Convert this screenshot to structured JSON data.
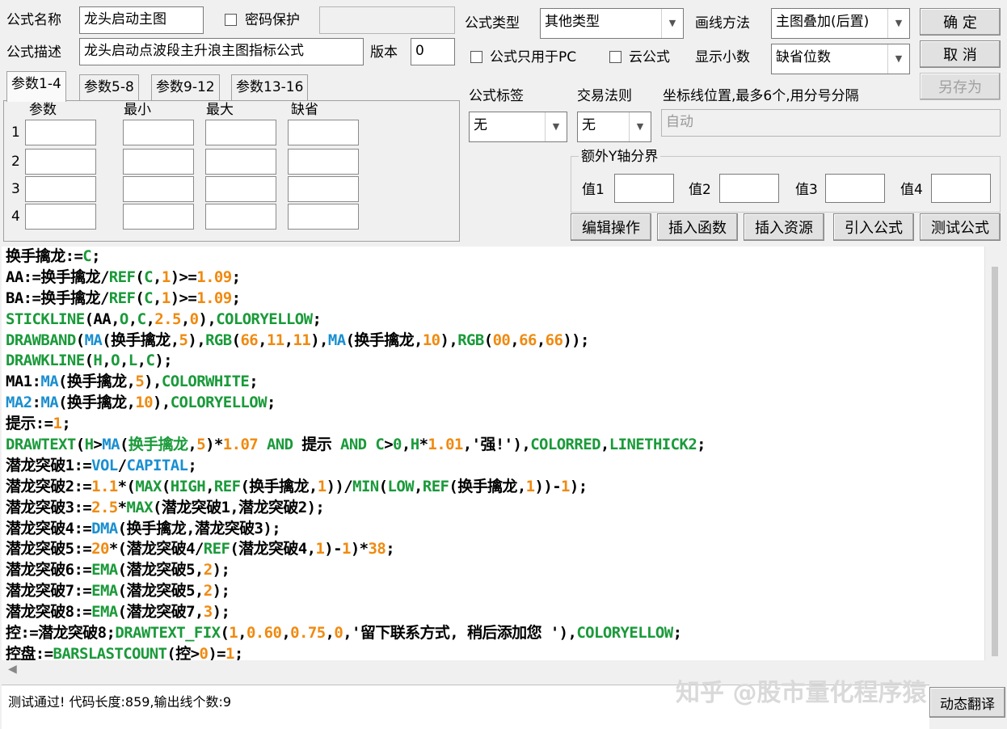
{
  "form": {
    "name_label": "公式名称",
    "name_value": "龙头启动主图",
    "password_label": "密码保护",
    "desc_label": "公式描述",
    "desc_value": "龙头启动点波段主升浪主图指标公式",
    "version_label": "版本",
    "version_value": "0",
    "type_label": "公式类型",
    "type_value": "其他类型",
    "draw_label": "画线方法",
    "draw_value": "主图叠加(后置)",
    "pc_only_label": "公式只用于PC",
    "cloud_label": "云公式",
    "decimals_label": "显示小数",
    "decimals_value": "缺省位数",
    "tag_label": "公式标签",
    "tag_value": "无",
    "rule_label": "交易法则",
    "rule_value": "无",
    "coord_label": "坐标线位置,最多6个,用分号分隔",
    "coord_placeholder": "自动",
    "yaxis_group": "额外Y轴分界",
    "val1": "值1",
    "val2": "值2",
    "val3": "值3",
    "val4": "值4"
  },
  "buttons": {
    "ok": "确 定",
    "cancel": "取 消",
    "save_as": "另存为",
    "edit": "编辑操作",
    "insert_func": "插入函数",
    "insert_res": "插入资源",
    "import": "引入公式",
    "test": "测试公式",
    "translate": "动态翻译"
  },
  "tabs": [
    "参数1-4",
    "参数5-8",
    "参数9-12",
    "参数13-16"
  ],
  "params": {
    "headers": [
      "参数",
      "最小",
      "最大",
      "缺省"
    ],
    "rows": [
      "1",
      "2",
      "3",
      "4"
    ]
  },
  "code": [
    [
      [
        "t",
        "换手擒龙:="
      ],
      [
        "g",
        "C"
      ],
      [
        "t",
        ";"
      ]
    ],
    [
      [
        "t",
        "AA:=换手擒龙/"
      ],
      [
        "g",
        "REF"
      ],
      [
        "t",
        "("
      ],
      [
        "g",
        "C"
      ],
      [
        "t",
        ","
      ],
      [
        "o",
        "1"
      ],
      [
        "t",
        ")>="
      ],
      [
        "o",
        "1.09"
      ],
      [
        "t",
        ";"
      ]
    ],
    [
      [
        "t",
        "BA:=换手擒龙/"
      ],
      [
        "g",
        "REF"
      ],
      [
        "t",
        "("
      ],
      [
        "g",
        "C"
      ],
      [
        "t",
        ","
      ],
      [
        "o",
        "1"
      ],
      [
        "t",
        ")>="
      ],
      [
        "o",
        "1.09"
      ],
      [
        "t",
        ";"
      ]
    ],
    [
      [
        "g",
        "STICKLINE"
      ],
      [
        "t",
        "(AA,"
      ],
      [
        "g",
        "O"
      ],
      [
        "t",
        ","
      ],
      [
        "g",
        "C"
      ],
      [
        "t",
        ","
      ],
      [
        "o",
        "2.5"
      ],
      [
        "t",
        ","
      ],
      [
        "o",
        "0"
      ],
      [
        "t",
        "),"
      ],
      [
        "g",
        "COLORYELLOW"
      ],
      [
        "t",
        ";"
      ]
    ],
    [
      [
        "g",
        "DRAWBAND"
      ],
      [
        "t",
        "("
      ],
      [
        "b",
        "MA"
      ],
      [
        "t",
        "(换手擒龙,"
      ],
      [
        "o",
        "5"
      ],
      [
        "t",
        "),"
      ],
      [
        "g",
        "RGB"
      ],
      [
        "t",
        "("
      ],
      [
        "o",
        "66"
      ],
      [
        "t",
        ","
      ],
      [
        "o",
        "11"
      ],
      [
        "t",
        ","
      ],
      [
        "o",
        "11"
      ],
      [
        "t",
        "),"
      ],
      [
        "b",
        "MA"
      ],
      [
        "t",
        "(换手擒龙,"
      ],
      [
        "o",
        "10"
      ],
      [
        "t",
        "),"
      ],
      [
        "g",
        "RGB"
      ],
      [
        "t",
        "("
      ],
      [
        "o",
        "00"
      ],
      [
        "t",
        ","
      ],
      [
        "o",
        "66"
      ],
      [
        "t",
        ","
      ],
      [
        "o",
        "66"
      ],
      [
        "t",
        "));"
      ]
    ],
    [
      [
        "g",
        "DRAWKLINE"
      ],
      [
        "t",
        "("
      ],
      [
        "g",
        "H"
      ],
      [
        "t",
        ","
      ],
      [
        "g",
        "O"
      ],
      [
        "t",
        ","
      ],
      [
        "g",
        "L"
      ],
      [
        "t",
        ","
      ],
      [
        "g",
        "C"
      ],
      [
        "t",
        ");"
      ]
    ],
    [
      [
        "t",
        "MA1:"
      ],
      [
        "b",
        "MA"
      ],
      [
        "t",
        "(换手擒龙,"
      ],
      [
        "o",
        "5"
      ],
      [
        "t",
        "),"
      ],
      [
        "g",
        "COLORWHITE"
      ],
      [
        "t",
        ";"
      ]
    ],
    [
      [
        "b",
        "MA2"
      ],
      [
        "t",
        ":"
      ],
      [
        "b",
        "MA"
      ],
      [
        "t",
        "(换手擒龙,"
      ],
      [
        "o",
        "10"
      ],
      [
        "t",
        "),"
      ],
      [
        "g",
        "COLORYELLOW"
      ],
      [
        "t",
        ";"
      ]
    ],
    [
      [
        "t",
        "提示:="
      ],
      [
        "o",
        "1"
      ],
      [
        "t",
        ";"
      ]
    ],
    [
      [
        "g",
        "DRAWTEXT"
      ],
      [
        "t",
        "("
      ],
      [
        "g",
        "H"
      ],
      [
        "t",
        ">"
      ],
      [
        "b",
        "MA"
      ],
      [
        "t",
        "("
      ],
      [
        "g",
        "换手擒龙"
      ],
      [
        "t",
        ","
      ],
      [
        "o",
        "5"
      ],
      [
        "t",
        ")*"
      ],
      [
        "o",
        "1.07"
      ],
      [
        "g",
        " AND "
      ],
      [
        "t",
        "提示"
      ],
      [
        "g",
        " AND C"
      ],
      [
        "t",
        ">"
      ],
      [
        "g",
        "0"
      ],
      [
        "t",
        ","
      ],
      [
        "g",
        "H"
      ],
      [
        "t",
        "*"
      ],
      [
        "o",
        "1.01"
      ],
      [
        "t",
        ",'强!'),"
      ],
      [
        "g",
        "COLORRED"
      ],
      [
        "t",
        ","
      ],
      [
        "g",
        "LINETHICK2"
      ],
      [
        "t",
        ";"
      ]
    ],
    [
      [
        "t",
        "潜龙突破1:="
      ],
      [
        "b",
        "VOL"
      ],
      [
        "t",
        "/"
      ],
      [
        "b",
        "CAPITAL"
      ],
      [
        "t",
        ";"
      ]
    ],
    [
      [
        "t",
        "潜龙突破2:="
      ],
      [
        "o",
        "1.1"
      ],
      [
        "t",
        "*("
      ],
      [
        "g",
        "MAX"
      ],
      [
        "t",
        "("
      ],
      [
        "g",
        "HIGH"
      ],
      [
        "t",
        ","
      ],
      [
        "g",
        "REF"
      ],
      [
        "t",
        "(换手擒龙,"
      ],
      [
        "o",
        "1"
      ],
      [
        "t",
        "))/"
      ],
      [
        "g",
        "MIN"
      ],
      [
        "t",
        "("
      ],
      [
        "g",
        "LOW"
      ],
      [
        "t",
        ","
      ],
      [
        "g",
        "REF"
      ],
      [
        "t",
        "(换手擒龙,"
      ],
      [
        "o",
        "1"
      ],
      [
        "t",
        "))-"
      ],
      [
        "o",
        "1"
      ],
      [
        "t",
        ");"
      ]
    ],
    [
      [
        "t",
        "潜龙突破3:="
      ],
      [
        "o",
        "2.5"
      ],
      [
        "t",
        "*"
      ],
      [
        "g",
        "MAX"
      ],
      [
        "t",
        "(潜龙突破1,潜龙突破2);"
      ]
    ],
    [
      [
        "t",
        "潜龙突破4:="
      ],
      [
        "b",
        "DMA"
      ],
      [
        "t",
        "(换手擒龙,潜龙突破3);"
      ]
    ],
    [
      [
        "t",
        "潜龙突破5:="
      ],
      [
        "o",
        "20"
      ],
      [
        "t",
        "*(潜龙突破4/"
      ],
      [
        "g",
        "REF"
      ],
      [
        "t",
        "(潜龙突破4,"
      ],
      [
        "o",
        "1"
      ],
      [
        "t",
        ")-"
      ],
      [
        "o",
        "1"
      ],
      [
        "t",
        ")*"
      ],
      [
        "o",
        "38"
      ],
      [
        "t",
        ";"
      ]
    ],
    [
      [
        "t",
        "潜龙突破6:="
      ],
      [
        "g",
        "EMA"
      ],
      [
        "t",
        "(潜龙突破5,"
      ],
      [
        "o",
        "2"
      ],
      [
        "t",
        ");"
      ]
    ],
    [
      [
        "t",
        "潜龙突破7:="
      ],
      [
        "g",
        "EMA"
      ],
      [
        "t",
        "(潜龙突破5,"
      ],
      [
        "o",
        "2"
      ],
      [
        "t",
        ");"
      ]
    ],
    [
      [
        "t",
        "潜龙突破8:="
      ],
      [
        "g",
        "EMA"
      ],
      [
        "t",
        "(潜龙突破7,"
      ],
      [
        "o",
        "3"
      ],
      [
        "t",
        ");"
      ]
    ],
    [
      [
        "t",
        "控:=潜龙突破8;"
      ],
      [
        "g",
        "DRAWTEXT_FIX"
      ],
      [
        "t",
        "("
      ],
      [
        "o",
        "1"
      ],
      [
        "t",
        ","
      ],
      [
        "o",
        "0.60"
      ],
      [
        "t",
        ","
      ],
      [
        "o",
        "0.75"
      ],
      [
        "t",
        ","
      ],
      [
        "o",
        "0"
      ],
      [
        "t",
        ",'留下联系方式, 稍后添加您 '),"
      ],
      [
        "g",
        "COLORYELLOW"
      ],
      [
        "t",
        ";"
      ]
    ],
    [
      [
        "t",
        "控盘:="
      ],
      [
        "g",
        "BARSLASTCOUNT"
      ],
      [
        "t",
        "(控>"
      ],
      [
        "o",
        "0"
      ],
      [
        "t",
        ")="
      ],
      [
        "o",
        "1"
      ],
      [
        "t",
        ";"
      ]
    ]
  ],
  "status": "测试通过! 代码长度:859,输出线个数:9",
  "watermark": "知乎 @股市量化程序猿",
  "colors": {
    "func": "#1a9a3a",
    "builtin": "#1a8fd0",
    "number": "#f08a10"
  }
}
